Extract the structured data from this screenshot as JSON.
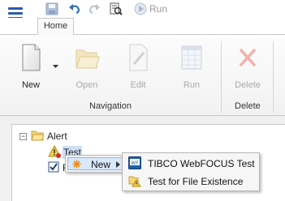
{
  "quick_access": {
    "run_label": "Run"
  },
  "tabs": [
    {
      "label": "Home"
    }
  ],
  "ribbon": {
    "new_label": "New",
    "open_label": "Open",
    "edit_label": "Edit",
    "run_label": "Run",
    "delete_label": "Delete",
    "group_navigation": "Navigation",
    "group_delete": "Delete"
  },
  "tree": {
    "root_label": "Alert",
    "child_label": "Test",
    "second_child_label": "F"
  },
  "context_menu": {
    "new_label": "New",
    "submenu": [
      {
        "label": "TIBCO WebFOCUS Test"
      },
      {
        "label": "Test for File Existence"
      }
    ]
  },
  "colors": {
    "accent": "#2b5ba8",
    "menu_highlight": "#d9e8fb"
  }
}
